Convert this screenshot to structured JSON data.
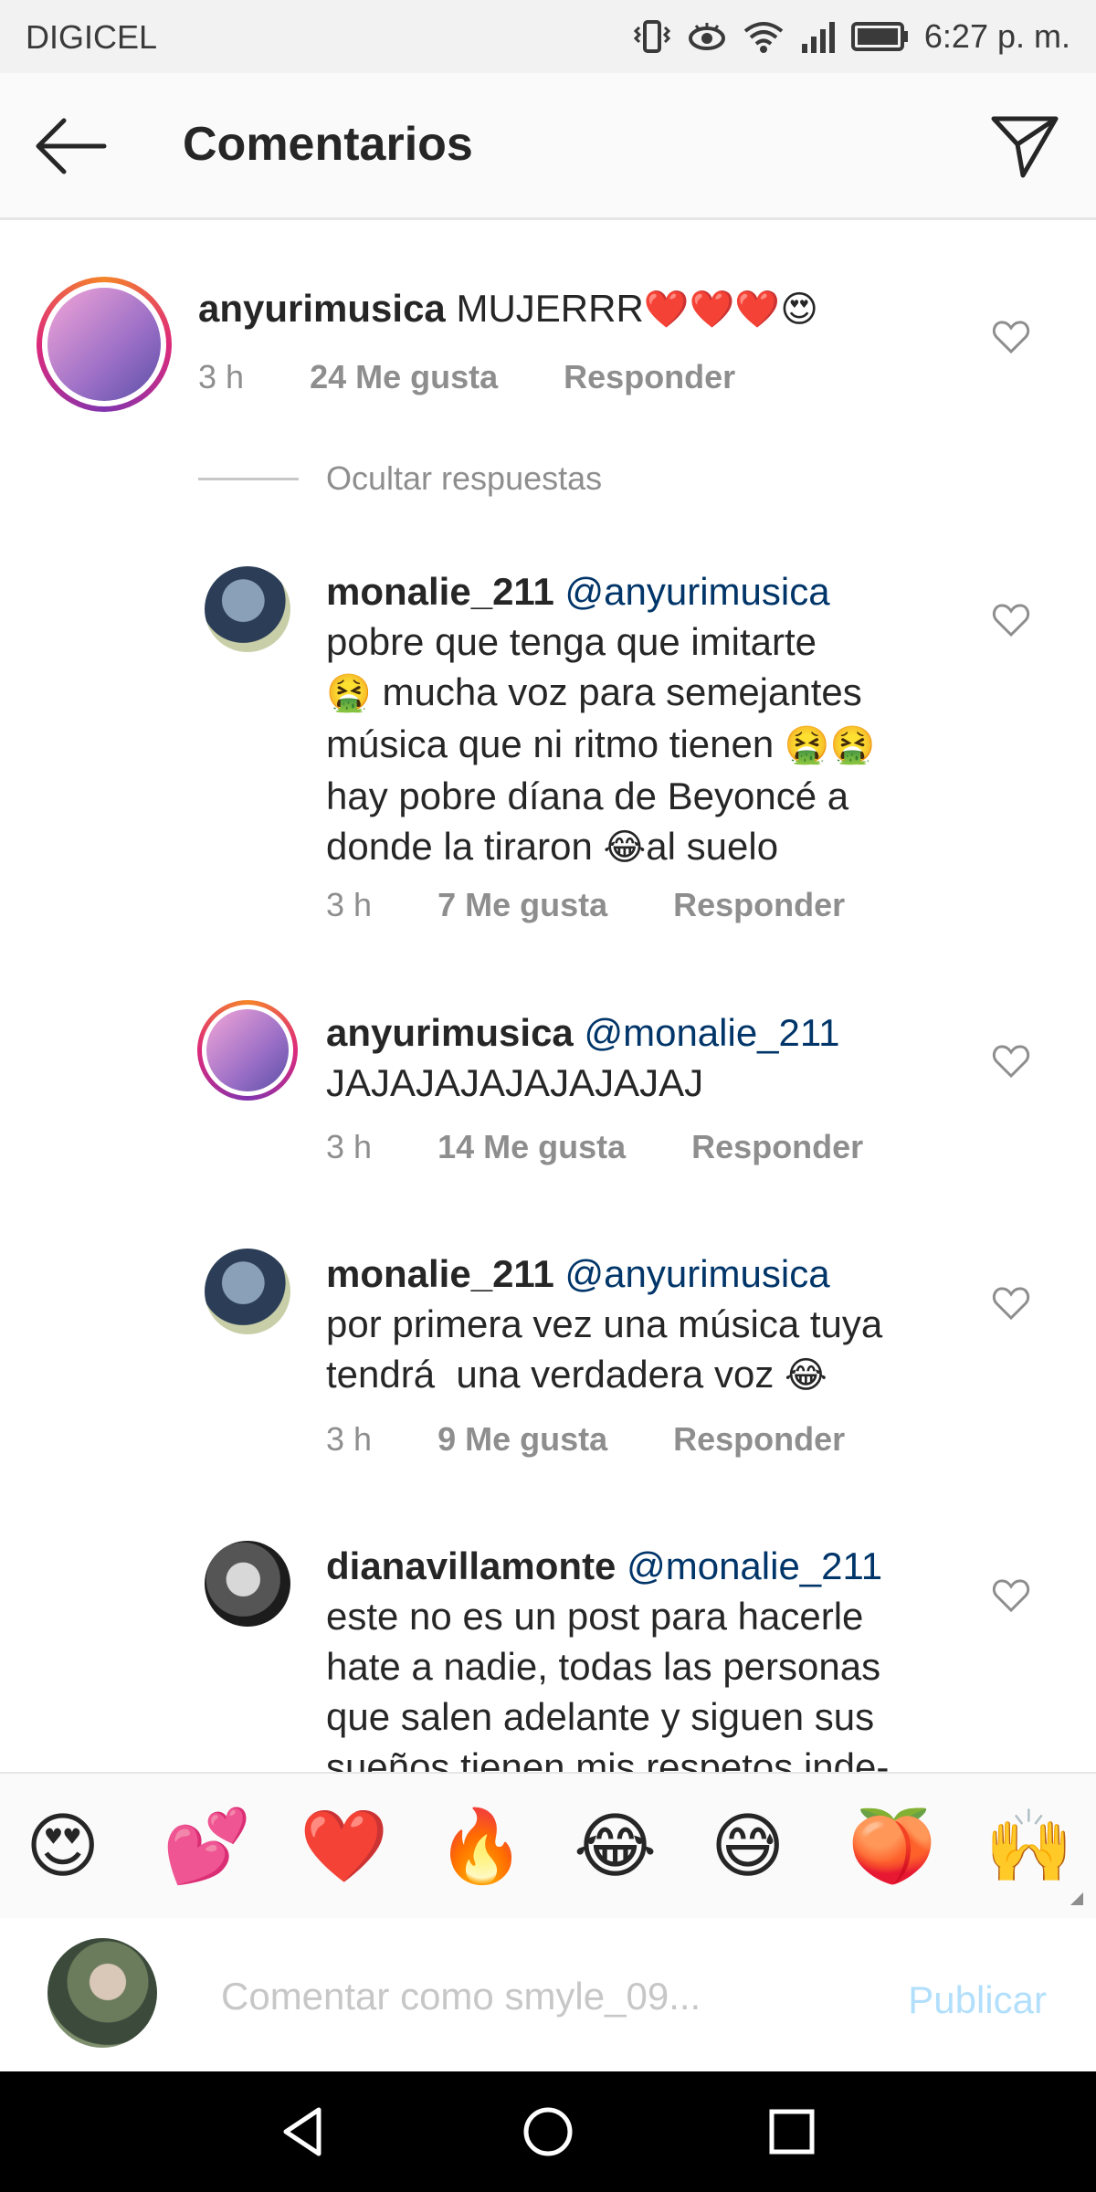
{
  "status_bar": {
    "carrier": "DIGICEL",
    "time": "6:27 p. m."
  },
  "header": {
    "title": "Comentarios"
  },
  "main_comment": {
    "username": "anyurimusica",
    "text": "MUJERRR",
    "emoji": "❤️❤️❤️😍",
    "time": "3 h",
    "likes": "24 Me gusta",
    "reply": "Responder"
  },
  "hide_replies": "Ocultar respuestas",
  "replies": [
    {
      "username": "monalie_211",
      "mention": "@anyurimusica",
      "line1": "pobre que tenga que imitarte",
      "line2_emoji": "🤮",
      "line2": " mucha voz para semejantes",
      "line3": "música que ni ritmo tienen ",
      "line3_emoji": "🤮🤮",
      "line4": "hay pobre díana de Beyoncé a",
      "line5": "donde la tiraron ",
      "line5_emoji": "😂",
      "line5_end": "al suelo",
      "time": "3 h",
      "likes": "7 Me gusta",
      "reply": "Responder"
    },
    {
      "username": "anyurimusica",
      "mention": "@monalie_211",
      "line1": "JAJAJAJAJAJAJAJAJ",
      "time": "3 h",
      "likes": "14 Me gusta",
      "reply": "Responder"
    },
    {
      "username": "monalie_211",
      "mention": "@anyurimusica",
      "line1": "por primera vez una música tuya",
      "line2": "tendrá  una verdadera voz ",
      "line2_emoji": "😂",
      "time": "3 h",
      "likes": "9 Me gusta",
      "reply": "Responder"
    },
    {
      "username": "dianavillamonte",
      "mention": "@monalie_211",
      "line1": "este no es un post para hacerle",
      "line2": "hate a nadie, todas las personas",
      "line3": "que salen adelante y siguen sus",
      "line4": "sueños tienen mis respetos inde-"
    }
  ],
  "emoji_bar": [
    "😍",
    "💕",
    "❤️",
    "🔥",
    "😂",
    "😅",
    "🍑",
    "🙌"
  ],
  "composer": {
    "placeholder": "Comentar como smyle_09...",
    "publish": "Publicar"
  },
  "icons": {
    "back": "arrow-left-icon",
    "send": "paper-plane-icon",
    "heart": "heart-outline-icon",
    "nav": [
      "nav-back-icon",
      "nav-home-icon",
      "nav-recents-icon"
    ]
  }
}
